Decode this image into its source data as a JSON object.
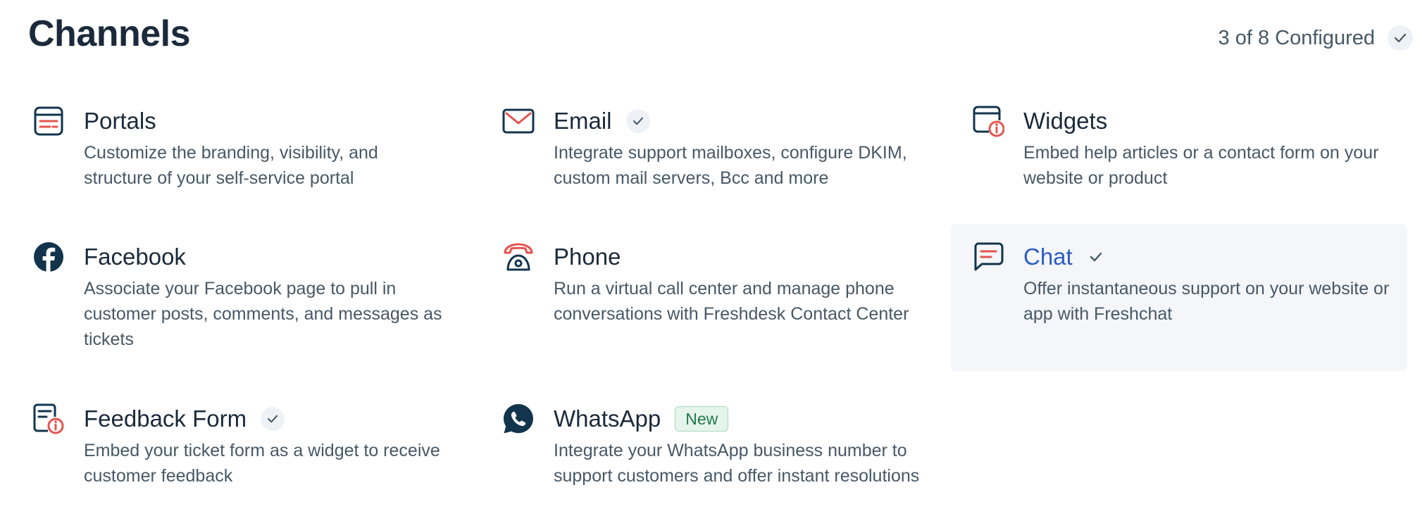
{
  "header": {
    "title": "Channels",
    "config_status": "3 of 8 Configured"
  },
  "colors": {
    "icon_dark": "#12344d",
    "icon_accent": "#e4544f",
    "active_title": "#2c5cc5",
    "active_bg": "#f4f6f9",
    "check": "#475867",
    "badge_green": "#1f7a4a"
  },
  "channels": [
    {
      "title": "Portals",
      "description": "Customize the branding, visibility, and structure of your self-service portal",
      "icon": "portal-icon",
      "configured": false
    },
    {
      "title": "Email",
      "description": "Integrate support mailboxes, configure DKIM, custom mail servers, Bcc and more",
      "icon": "envelope-icon",
      "configured": true
    },
    {
      "title": "Widgets",
      "description": "Embed help articles or a contact form on your website or product",
      "icon": "widget-icon",
      "configured": false
    },
    {
      "title": "Facebook",
      "description": "Associate your Facebook page to pull in customer posts, comments, and messages as tickets",
      "icon": "facebook-icon",
      "configured": false
    },
    {
      "title": "Phone",
      "description": "Run a virtual call center and manage phone conversations with Freshdesk Contact Center",
      "icon": "phone-icon",
      "configured": false
    },
    {
      "title": "Chat",
      "description": "Offer instantaneous support on your website or app with Freshchat",
      "icon": "chat-icon",
      "configured": true,
      "active": true
    },
    {
      "title": "Feedback Form",
      "description": "Embed your ticket form as a widget to receive customer feedback",
      "icon": "feedback-form-icon",
      "configured": true
    },
    {
      "title": "WhatsApp",
      "description": "Integrate your WhatsApp business number to support customers and offer instant resolutions",
      "icon": "whatsapp-icon",
      "configured": false,
      "badge": "New"
    }
  ]
}
